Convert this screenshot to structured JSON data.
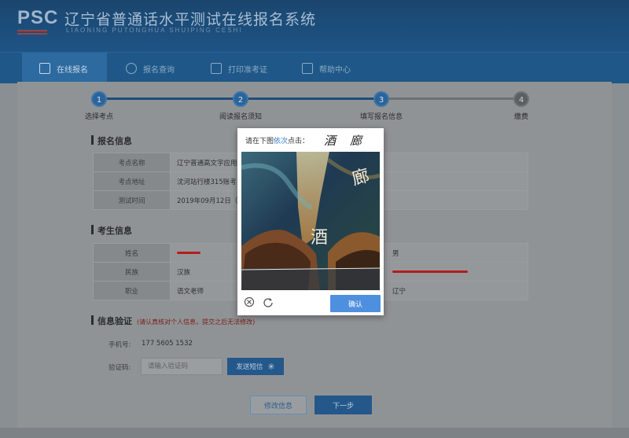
{
  "header": {
    "logo": "PSC",
    "title": "辽宁省普通话水平测试在线报名系统",
    "subtitle": "LIAONING PUTONGHUA SHUIPING CESHI"
  },
  "nav": {
    "items": [
      {
        "label": "在线报名",
        "icon": "edit-icon"
      },
      {
        "label": "报名查询",
        "icon": "search-icon"
      },
      {
        "label": "打印准考证",
        "icon": "printer-icon"
      },
      {
        "label": "帮助中心",
        "icon": "help-icon"
      }
    ]
  },
  "steps": [
    {
      "num": "1",
      "label": "选择考点"
    },
    {
      "num": "2",
      "label": "阅读报名须知"
    },
    {
      "num": "3",
      "label": "填写报名信息"
    },
    {
      "num": "4",
      "label": "缴费"
    }
  ],
  "registration": {
    "title": "报名信息",
    "rows": [
      {
        "key": "考点名称",
        "value": "辽宁普通高文字应用"
      },
      {
        "key": "考点地址",
        "value": "沈河站行楼315账考"
      },
      {
        "key": "测试时间",
        "value": "2019年09月12日（"
      }
    ]
  },
  "candidate": {
    "title": "考生信息",
    "rows": [
      {
        "k1": "姓名",
        "v1": "",
        "v2": "男"
      },
      {
        "k1": "民族",
        "v1": "汉族",
        "v2": ""
      },
      {
        "k1": "职业",
        "v1": "语文老师",
        "v2": "辽宁"
      }
    ]
  },
  "verify": {
    "title": "信息验证",
    "note": "(请认真核对个人信息，提交之后无法修改)",
    "phone_label": "手机号:",
    "phone_value": "177 5605 1532",
    "code_label": "验证码:",
    "code_placeholder": "请输入验证码",
    "sms_button": "发送短信"
  },
  "actions": {
    "modify": "修改信息",
    "next": "下一步"
  },
  "captcha": {
    "prompt_prefix": "请在下图",
    "prompt_highlight": "依次",
    "prompt_suffix": "点击：",
    "chars": [
      "酒",
      "廊"
    ],
    "img_char_1": "酒",
    "img_char_2": "廊",
    "confirm": "确认",
    "icons": [
      "close-circle-icon",
      "refresh-icon"
    ]
  },
  "colors": {
    "header_bg": "#1a466e",
    "nav_bg": "#1f5888",
    "accent": "#24588a",
    "confirm_btn": "#4f8fe0",
    "redaction": "#b51c1c"
  }
}
